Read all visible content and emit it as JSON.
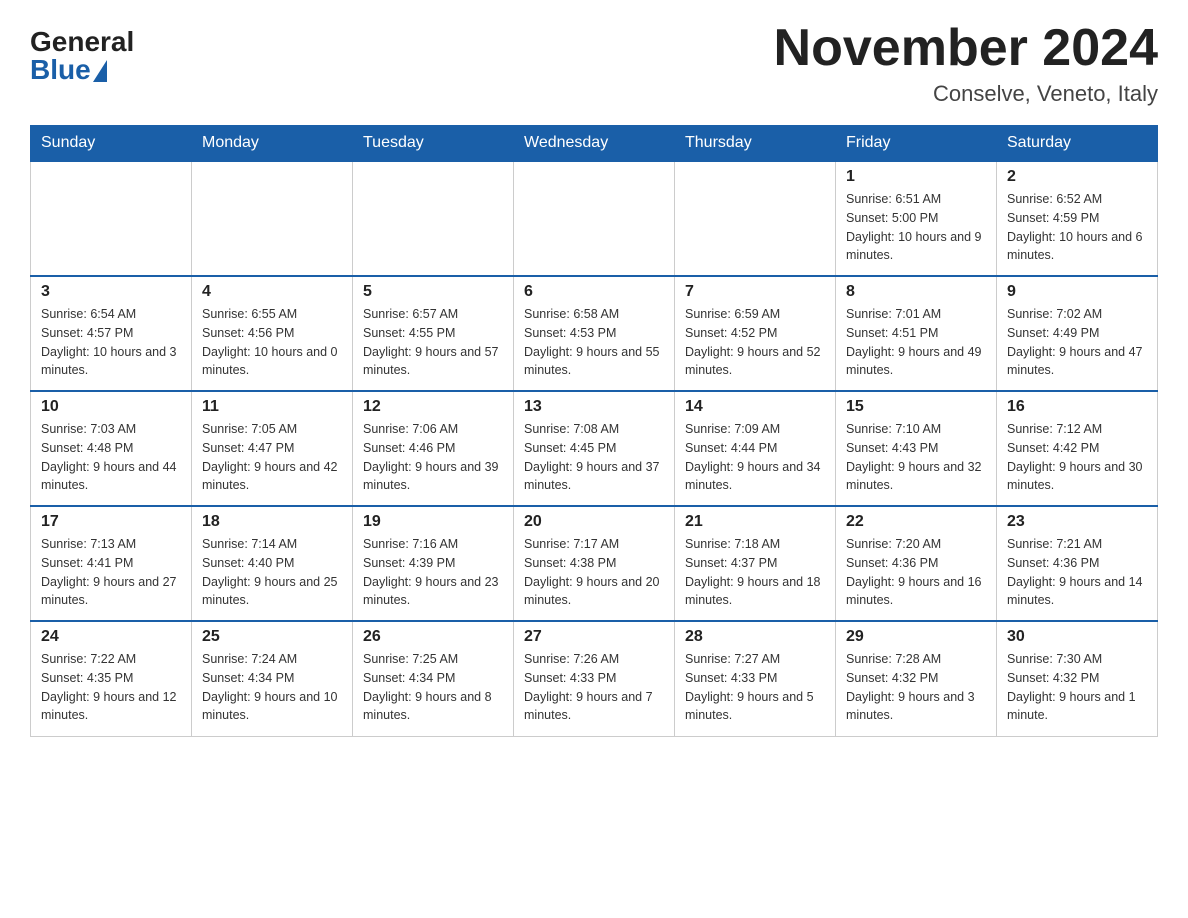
{
  "header": {
    "logo_general": "General",
    "logo_blue": "Blue",
    "month_title": "November 2024",
    "location": "Conselve, Veneto, Italy"
  },
  "weekdays": [
    "Sunday",
    "Monday",
    "Tuesday",
    "Wednesday",
    "Thursday",
    "Friday",
    "Saturday"
  ],
  "weeks": [
    [
      {
        "day": "",
        "sunrise": "",
        "sunset": "",
        "daylight": ""
      },
      {
        "day": "",
        "sunrise": "",
        "sunset": "",
        "daylight": ""
      },
      {
        "day": "",
        "sunrise": "",
        "sunset": "",
        "daylight": ""
      },
      {
        "day": "",
        "sunrise": "",
        "sunset": "",
        "daylight": ""
      },
      {
        "day": "",
        "sunrise": "",
        "sunset": "",
        "daylight": ""
      },
      {
        "day": "1",
        "sunrise": "Sunrise: 6:51 AM",
        "sunset": "Sunset: 5:00 PM",
        "daylight": "Daylight: 10 hours and 9 minutes."
      },
      {
        "day": "2",
        "sunrise": "Sunrise: 6:52 AM",
        "sunset": "Sunset: 4:59 PM",
        "daylight": "Daylight: 10 hours and 6 minutes."
      }
    ],
    [
      {
        "day": "3",
        "sunrise": "Sunrise: 6:54 AM",
        "sunset": "Sunset: 4:57 PM",
        "daylight": "Daylight: 10 hours and 3 minutes."
      },
      {
        "day": "4",
        "sunrise": "Sunrise: 6:55 AM",
        "sunset": "Sunset: 4:56 PM",
        "daylight": "Daylight: 10 hours and 0 minutes."
      },
      {
        "day": "5",
        "sunrise": "Sunrise: 6:57 AM",
        "sunset": "Sunset: 4:55 PM",
        "daylight": "Daylight: 9 hours and 57 minutes."
      },
      {
        "day": "6",
        "sunrise": "Sunrise: 6:58 AM",
        "sunset": "Sunset: 4:53 PM",
        "daylight": "Daylight: 9 hours and 55 minutes."
      },
      {
        "day": "7",
        "sunrise": "Sunrise: 6:59 AM",
        "sunset": "Sunset: 4:52 PM",
        "daylight": "Daylight: 9 hours and 52 minutes."
      },
      {
        "day": "8",
        "sunrise": "Sunrise: 7:01 AM",
        "sunset": "Sunset: 4:51 PM",
        "daylight": "Daylight: 9 hours and 49 minutes."
      },
      {
        "day": "9",
        "sunrise": "Sunrise: 7:02 AM",
        "sunset": "Sunset: 4:49 PM",
        "daylight": "Daylight: 9 hours and 47 minutes."
      }
    ],
    [
      {
        "day": "10",
        "sunrise": "Sunrise: 7:03 AM",
        "sunset": "Sunset: 4:48 PM",
        "daylight": "Daylight: 9 hours and 44 minutes."
      },
      {
        "day": "11",
        "sunrise": "Sunrise: 7:05 AM",
        "sunset": "Sunset: 4:47 PM",
        "daylight": "Daylight: 9 hours and 42 minutes."
      },
      {
        "day": "12",
        "sunrise": "Sunrise: 7:06 AM",
        "sunset": "Sunset: 4:46 PM",
        "daylight": "Daylight: 9 hours and 39 minutes."
      },
      {
        "day": "13",
        "sunrise": "Sunrise: 7:08 AM",
        "sunset": "Sunset: 4:45 PM",
        "daylight": "Daylight: 9 hours and 37 minutes."
      },
      {
        "day": "14",
        "sunrise": "Sunrise: 7:09 AM",
        "sunset": "Sunset: 4:44 PM",
        "daylight": "Daylight: 9 hours and 34 minutes."
      },
      {
        "day": "15",
        "sunrise": "Sunrise: 7:10 AM",
        "sunset": "Sunset: 4:43 PM",
        "daylight": "Daylight: 9 hours and 32 minutes."
      },
      {
        "day": "16",
        "sunrise": "Sunrise: 7:12 AM",
        "sunset": "Sunset: 4:42 PM",
        "daylight": "Daylight: 9 hours and 30 minutes."
      }
    ],
    [
      {
        "day": "17",
        "sunrise": "Sunrise: 7:13 AM",
        "sunset": "Sunset: 4:41 PM",
        "daylight": "Daylight: 9 hours and 27 minutes."
      },
      {
        "day": "18",
        "sunrise": "Sunrise: 7:14 AM",
        "sunset": "Sunset: 4:40 PM",
        "daylight": "Daylight: 9 hours and 25 minutes."
      },
      {
        "day": "19",
        "sunrise": "Sunrise: 7:16 AM",
        "sunset": "Sunset: 4:39 PM",
        "daylight": "Daylight: 9 hours and 23 minutes."
      },
      {
        "day": "20",
        "sunrise": "Sunrise: 7:17 AM",
        "sunset": "Sunset: 4:38 PM",
        "daylight": "Daylight: 9 hours and 20 minutes."
      },
      {
        "day": "21",
        "sunrise": "Sunrise: 7:18 AM",
        "sunset": "Sunset: 4:37 PM",
        "daylight": "Daylight: 9 hours and 18 minutes."
      },
      {
        "day": "22",
        "sunrise": "Sunrise: 7:20 AM",
        "sunset": "Sunset: 4:36 PM",
        "daylight": "Daylight: 9 hours and 16 minutes."
      },
      {
        "day": "23",
        "sunrise": "Sunrise: 7:21 AM",
        "sunset": "Sunset: 4:36 PM",
        "daylight": "Daylight: 9 hours and 14 minutes."
      }
    ],
    [
      {
        "day": "24",
        "sunrise": "Sunrise: 7:22 AM",
        "sunset": "Sunset: 4:35 PM",
        "daylight": "Daylight: 9 hours and 12 minutes."
      },
      {
        "day": "25",
        "sunrise": "Sunrise: 7:24 AM",
        "sunset": "Sunset: 4:34 PM",
        "daylight": "Daylight: 9 hours and 10 minutes."
      },
      {
        "day": "26",
        "sunrise": "Sunrise: 7:25 AM",
        "sunset": "Sunset: 4:34 PM",
        "daylight": "Daylight: 9 hours and 8 minutes."
      },
      {
        "day": "27",
        "sunrise": "Sunrise: 7:26 AM",
        "sunset": "Sunset: 4:33 PM",
        "daylight": "Daylight: 9 hours and 7 minutes."
      },
      {
        "day": "28",
        "sunrise": "Sunrise: 7:27 AM",
        "sunset": "Sunset: 4:33 PM",
        "daylight": "Daylight: 9 hours and 5 minutes."
      },
      {
        "day": "29",
        "sunrise": "Sunrise: 7:28 AM",
        "sunset": "Sunset: 4:32 PM",
        "daylight": "Daylight: 9 hours and 3 minutes."
      },
      {
        "day": "30",
        "sunrise": "Sunrise: 7:30 AM",
        "sunset": "Sunset: 4:32 PM",
        "daylight": "Daylight: 9 hours and 1 minute."
      }
    ]
  ]
}
